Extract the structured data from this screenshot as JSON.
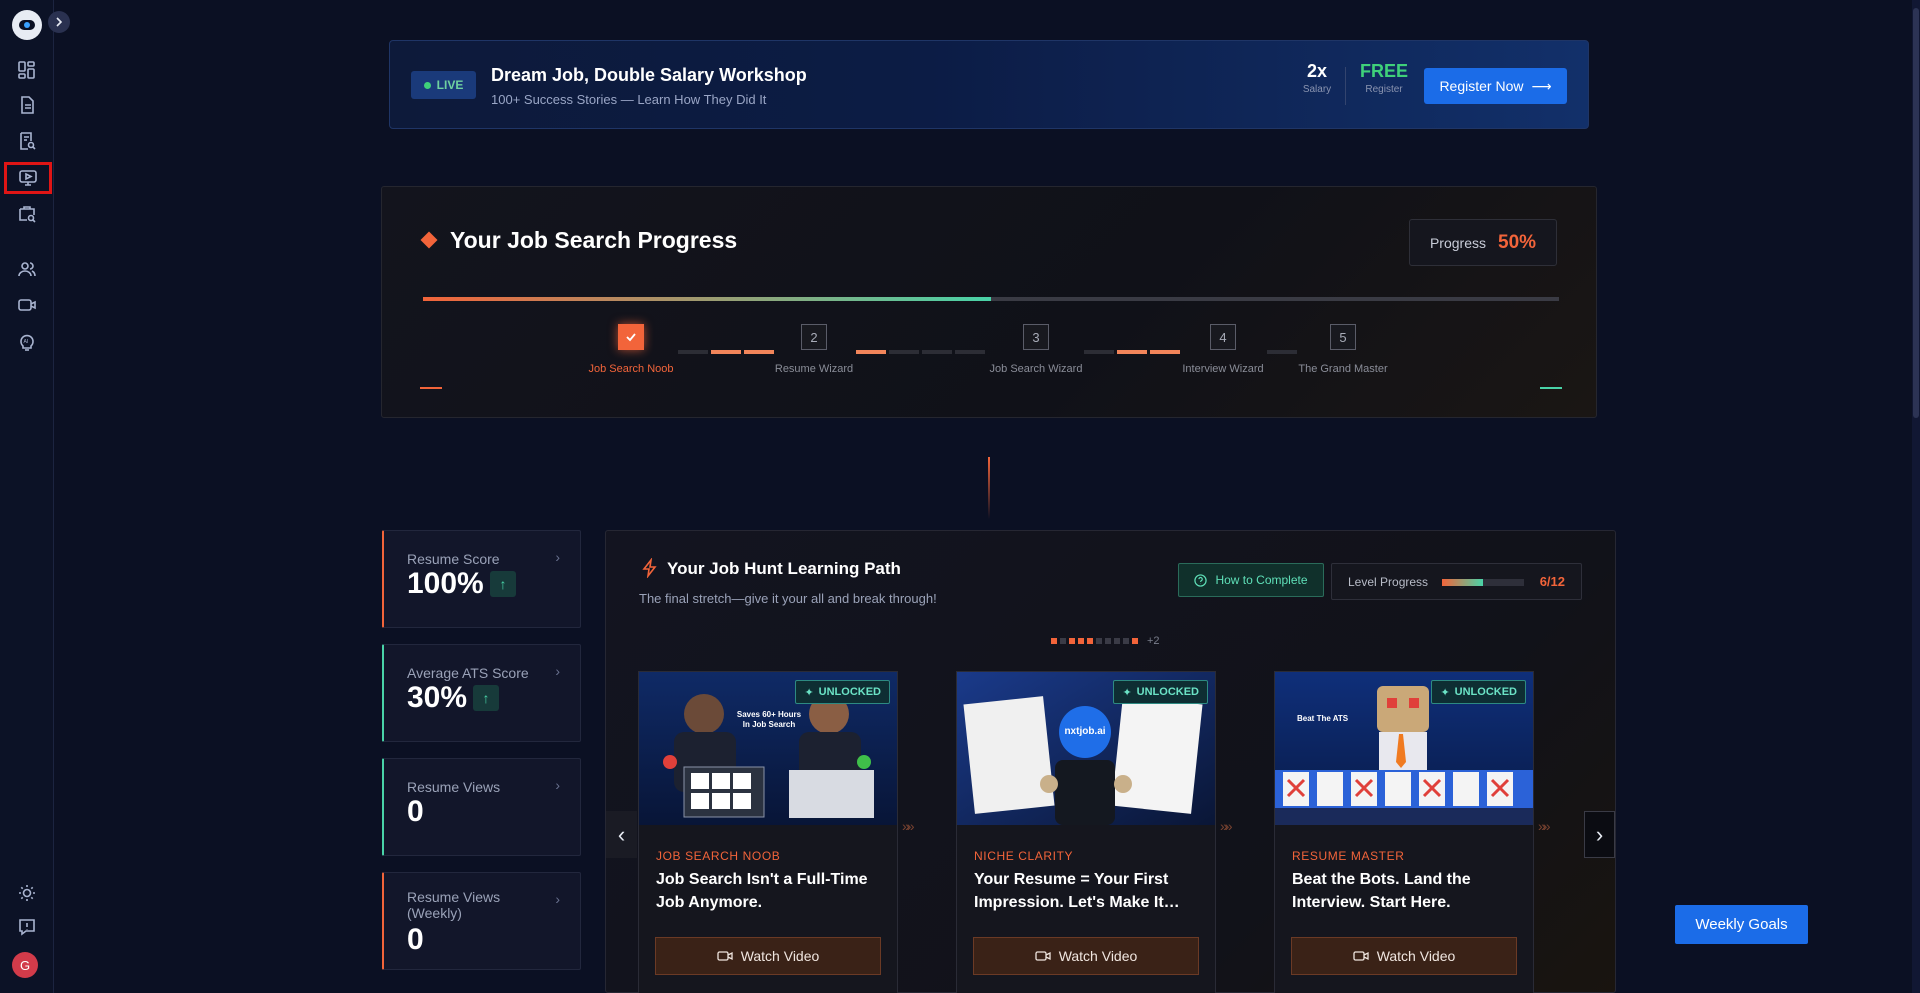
{
  "sidebar": {
    "items": [
      {
        "icon": "dashboard-icon"
      },
      {
        "icon": "document-icon"
      },
      {
        "icon": "resume-search-icon"
      },
      {
        "icon": "video-monitor-icon",
        "active": true
      },
      {
        "icon": "job-search-icon"
      },
      {
        "icon": "users-icon"
      },
      {
        "icon": "video-camera-icon"
      },
      {
        "icon": "ai-bulb-icon"
      }
    ],
    "bottom": [
      {
        "icon": "theme-sun-icon"
      },
      {
        "icon": "help-icon"
      }
    ],
    "avatar_initial": "G"
  },
  "banner": {
    "live_label": "LIVE",
    "title": "Dream Job, Double Salary Workshop",
    "subtitle": "100+ Success Stories — Learn How They Did It",
    "stat1_value": "2x",
    "stat1_label": "Salary",
    "stat2_value": "FREE",
    "stat2_label": "Register",
    "register_label": "Register Now"
  },
  "progress": {
    "title": "Your Job Search Progress",
    "pill_label": "Progress",
    "pill_value": "50%",
    "fraction": 0.5,
    "steps": [
      {
        "num": "1",
        "label": "Job Search Noob",
        "done": true
      },
      {
        "num": "2",
        "label": "Resume Wizard",
        "done": false
      },
      {
        "num": "3",
        "label": "Job Search Wizard",
        "done": false
      },
      {
        "num": "4",
        "label": "Interview Wizard",
        "done": false
      },
      {
        "num": "5",
        "label": "The Grand Master",
        "done": false
      }
    ]
  },
  "stats": [
    {
      "title": "Resume Score",
      "value": "100%",
      "trend": "up"
    },
    {
      "title": "Average ATS Score",
      "value": "30%",
      "trend": "up"
    },
    {
      "title": "Resume Views",
      "value": "0"
    },
    {
      "title": "Resume Views (Weekly)",
      "value": "0"
    }
  ],
  "learning": {
    "title": "Your Job Hunt Learning Path",
    "subtitle": "The final stretch—give it your all and break through!",
    "how_label": "How to Complete",
    "level_label": "Level Progress",
    "level_value": "6/12",
    "level_fraction": 0.5,
    "dots_more": "+2",
    "cards": [
      {
        "badge": "UNLOCKED",
        "category": "JOB SEARCH NOOB",
        "title": "Job Search Isn't a Full-Time Job Anymore.",
        "button": "Watch Video",
        "art_text": "Saves 60+ Hours In Job Search"
      },
      {
        "badge": "UNLOCKED",
        "category": "NICHE CLARITY",
        "title": "Your Resume = Your First Impression. Let's Make It…",
        "button": "Watch Video",
        "art_text": "nxtjob.ai"
      },
      {
        "badge": "UNLOCKED",
        "category": "RESUME MASTER",
        "title": "Beat the Bots. Land the Interview. Start Here.",
        "button": "Watch Video",
        "art_text": "Beat The ATS"
      }
    ]
  },
  "weekly_goals_label": "Weekly Goals",
  "colors": {
    "accent": "#f2643a",
    "teal": "#49d3a8",
    "blue": "#1b6ce8"
  }
}
